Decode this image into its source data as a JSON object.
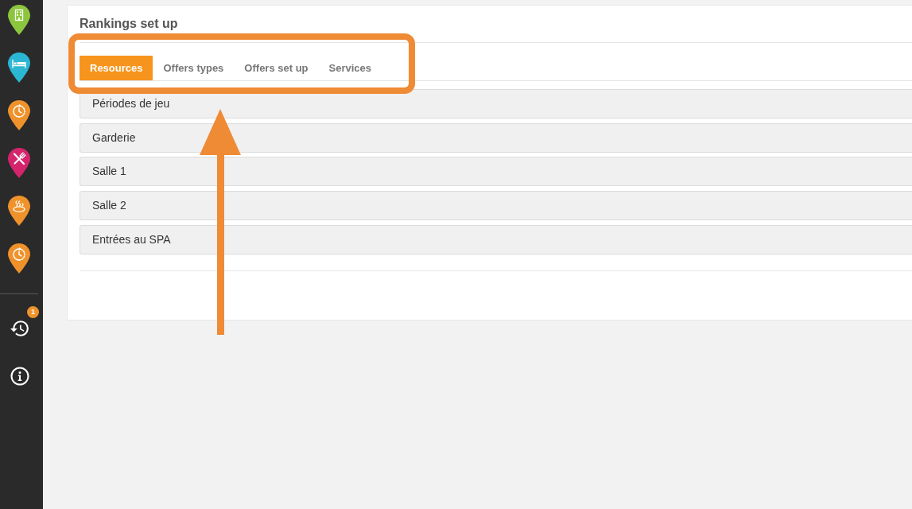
{
  "sidebar": {
    "items": [
      {
        "kind": "building",
        "color": "#8cc63f"
      },
      {
        "kind": "bed",
        "color": "#2bb6d3"
      },
      {
        "kind": "clock",
        "color": "#f0922b"
      },
      {
        "kind": "cutlery",
        "color": "#d4256c"
      },
      {
        "kind": "spa",
        "color": "#f0922b"
      },
      {
        "kind": "clock",
        "color": "#f0922b"
      }
    ],
    "history": {
      "badge": "1"
    }
  },
  "panel": {
    "title": "Rankings set up",
    "tabs": [
      {
        "label": "Resources",
        "selected": true
      },
      {
        "label": "Offers types",
        "selected": false
      },
      {
        "label": "Offers set up",
        "selected": false
      },
      {
        "label": "Services",
        "selected": false
      }
    ],
    "resources": [
      "Périodes de jeu",
      "Garderie",
      "Salle 1",
      "Salle 2",
      "Entrées au SPA"
    ]
  }
}
